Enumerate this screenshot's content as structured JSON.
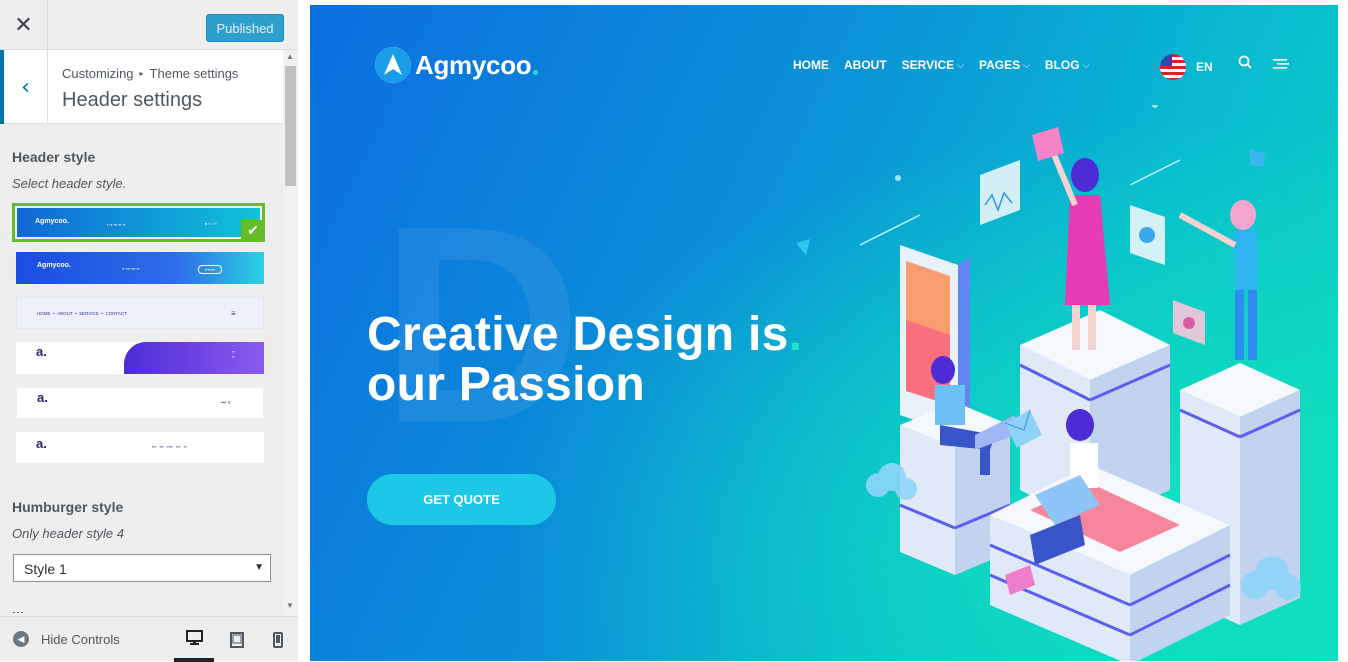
{
  "customizer": {
    "close_glyph": "✕",
    "publish_label": "Published",
    "back_glyph": "‹",
    "breadcrumb": {
      "root": "Customizing",
      "sep": "▸",
      "parent": "Theme settings"
    },
    "section_title": "Header settings",
    "header_style": {
      "label": "Header style",
      "description": "Select header style.",
      "selected_index": 0,
      "options": [
        {
          "id": "style-1"
        },
        {
          "id": "style-2"
        },
        {
          "id": "style-3"
        },
        {
          "id": "style-4"
        },
        {
          "id": "style-5"
        },
        {
          "id": "style-6"
        }
      ]
    },
    "hamburger_style": {
      "label": "Humburger style",
      "description": "Only header style 4",
      "value": "Style 1"
    },
    "footer": {
      "hide_controls": "Hide Controls",
      "devices": [
        "desktop-icon",
        "tablet-icon",
        "mobile-icon"
      ],
      "active_device": "desktop"
    }
  },
  "site": {
    "logo": {
      "text": "Agmycoo",
      "icon": "arrow-logo-icon"
    },
    "nav": {
      "home": "HOME",
      "about": "ABOUT",
      "service": "SERVICE",
      "pages": "PAGES",
      "blog": "BLOG",
      "chevron": "⌵"
    },
    "language": "EN",
    "hero": {
      "line1": "Creative Design is",
      "line2": "our Passion",
      "bg_letter": "D",
      "cta": "GET QUOTE"
    },
    "colors": {
      "brand_accent": "#22e3c4",
      "cta": "#1cc7e8",
      "gradient_start": "#0c6fe0",
      "gradient_end": "#0fd8bf"
    }
  },
  "thumbnails": {
    "brand": "Agmycoo.",
    "nav3": [
      "HOME",
      "ABOUT",
      "SERVICE",
      "CONTACT"
    ],
    "mini_logo": "a."
  }
}
